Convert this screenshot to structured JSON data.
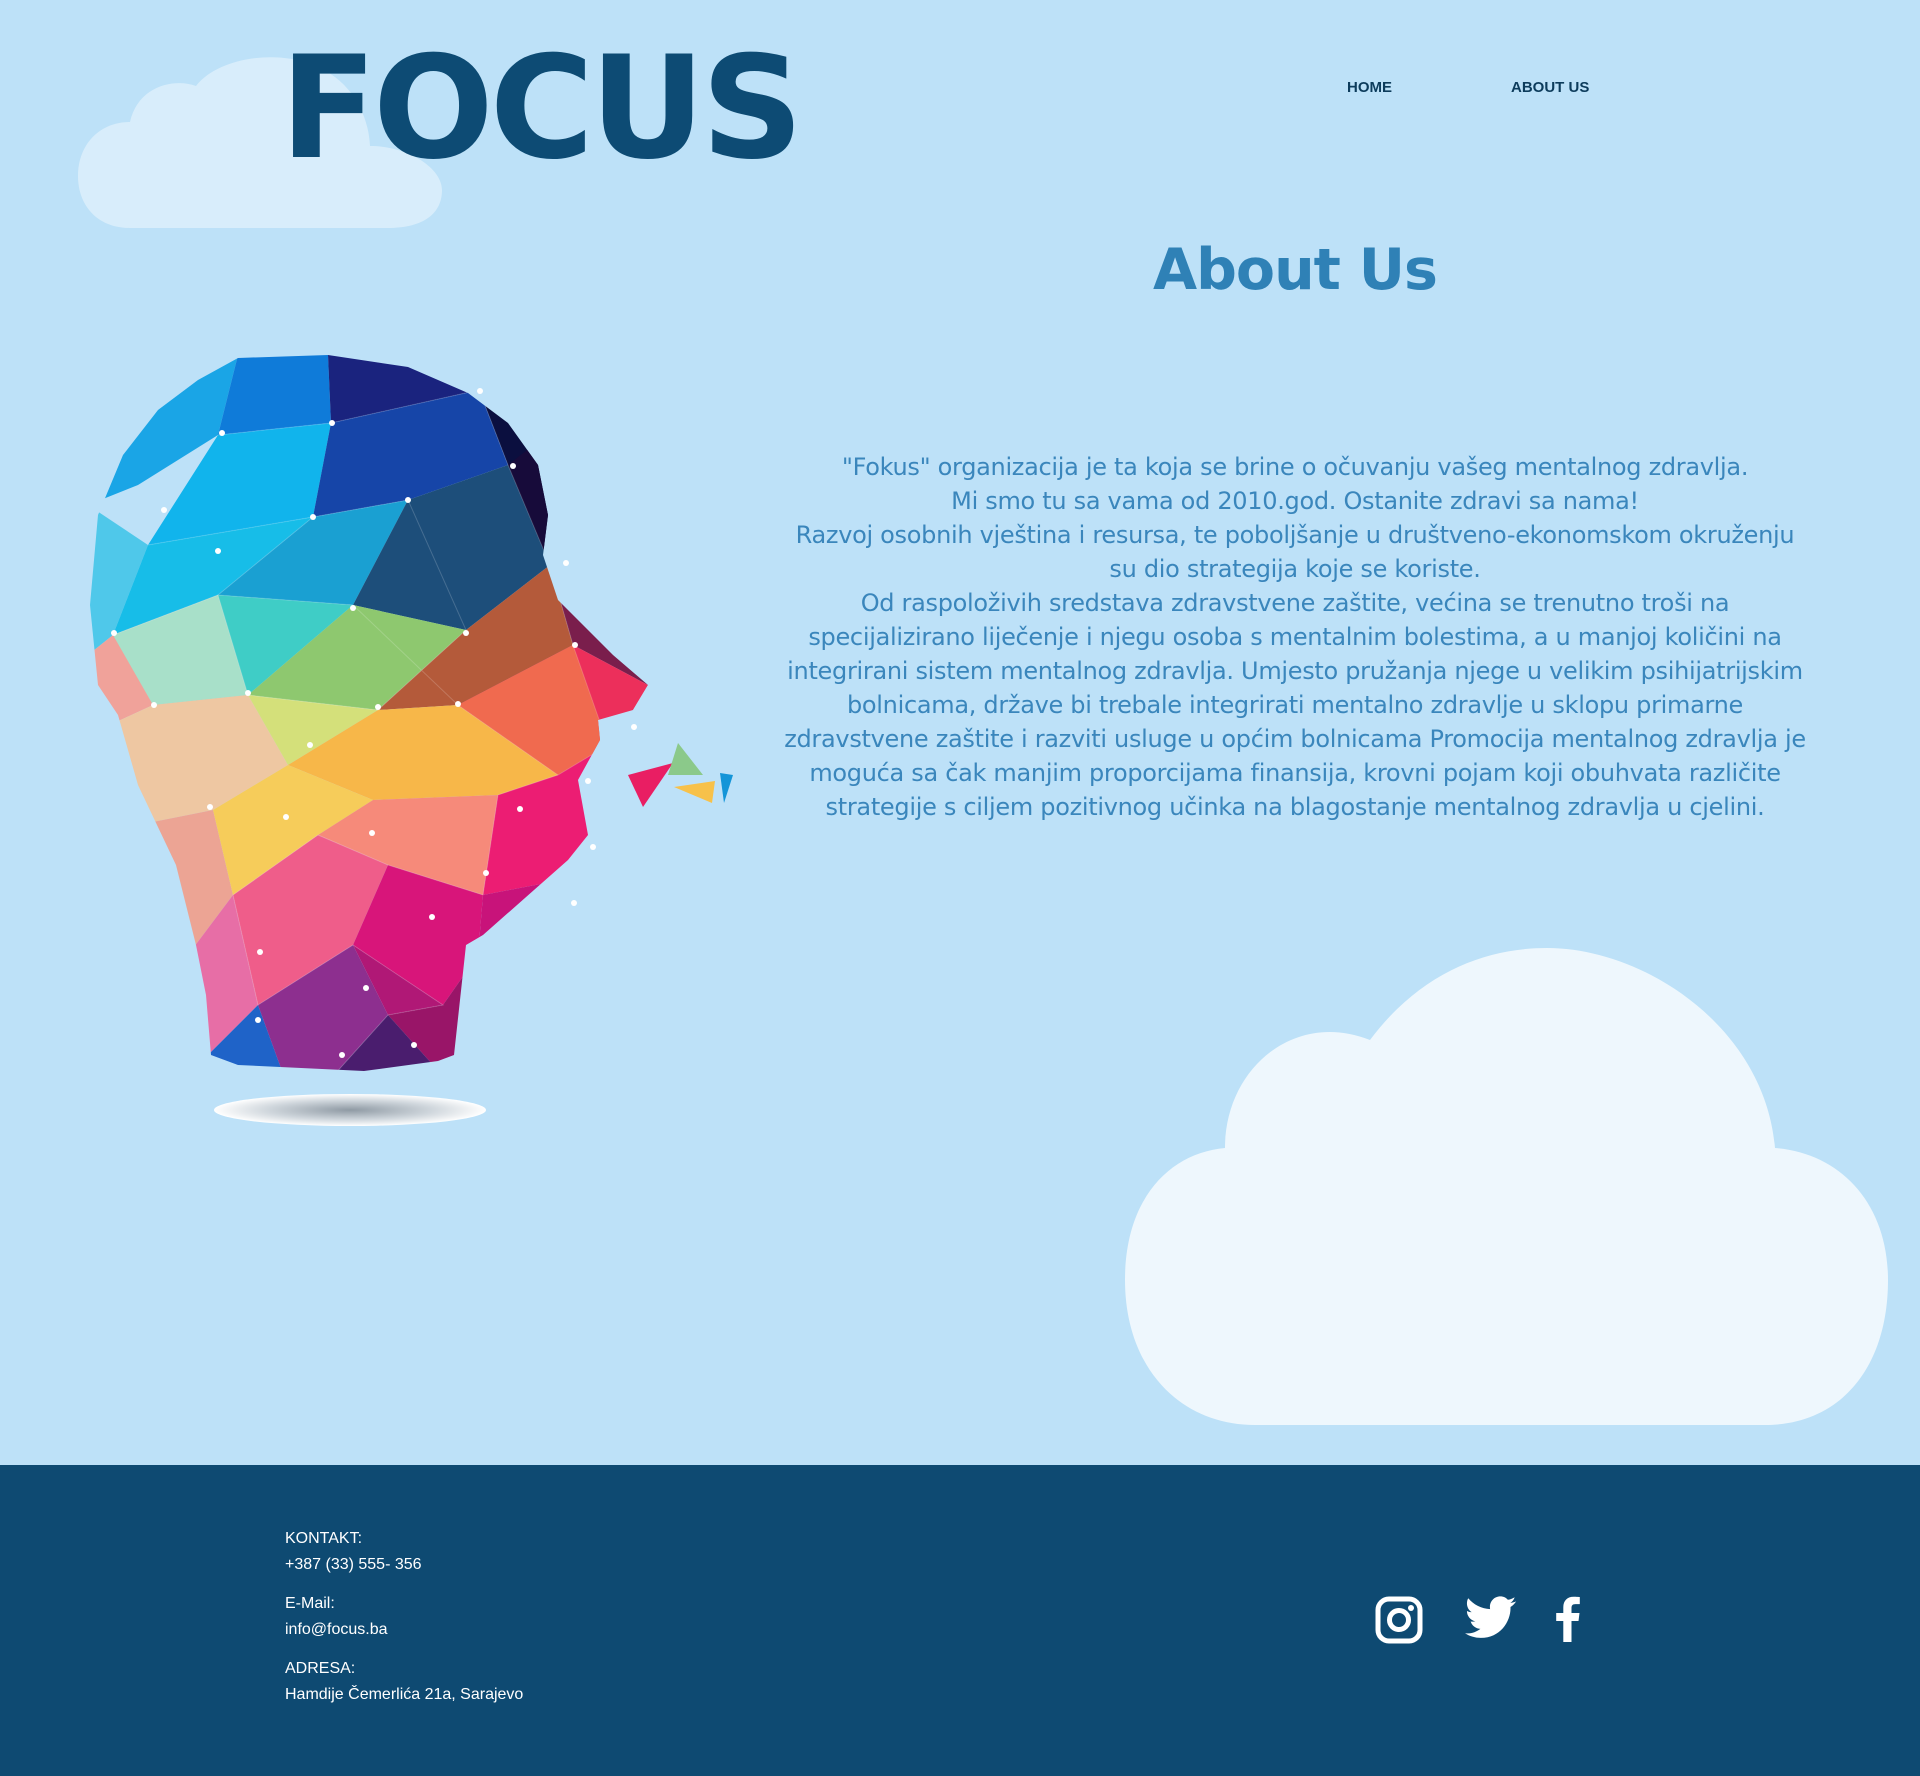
{
  "brand": {
    "logo_text": "FOCUS"
  },
  "nav": {
    "home": "HOME",
    "about": "ABOUT US"
  },
  "main": {
    "title": "About Us",
    "paragraphs": [
      "\"Fokus\" organizacija je ta koja se brine o očuvanju vašeg mentalnog zdravlja.",
      "Mi smo tu sa vama od 2010.god. Ostanite zdravi sa nama!",
      "Razvoj osobnih vještina i resursa, te poboljšanje u društveno-ekonomskom okruženju su dio strategija koje se koriste.",
      "Od raspoloživih sredstava zdravstvene zaštite, većina se trenutno troši na specijalizirano liječenje i njegu osoba s mentalnim bolestima,  a u  manjoj količini na integrirani sistem mentalnog zdravlja. Umjesto pružanja njege u velikim psihijatrijskim bolnicama, države bi trebale integrirati mentalno zdravlje u sklopu primarne zdravstvene zaštite i razviti usluge u općim bolnicama Promocija mentalnog zdravlja je moguća sa čak  manjim proporcijama finansija, krovni pojam koji obuhvata različite strategije s ciljem pozitivnog učinka na blagostanje mentalnog zdravlja u cjelini."
    ]
  },
  "footer": {
    "contact_label": "KONTAKT:",
    "phone": "+387 (33) 555- 356",
    "email_label": "E-Mail:",
    "email": "info@focus.ba",
    "address_label": "ADRESA:",
    "address": "Hamdije Čemerlića 21a, Sarajevo"
  },
  "social": {
    "icons": [
      "instagram-icon",
      "twitter-icon",
      "facebook-icon"
    ]
  },
  "colors": {
    "background": "#bde1f8",
    "footer": "#0e4a72",
    "logo": "#0d4b74",
    "heading": "#2f81b6",
    "body_text": "#3a86bc",
    "cloud": "#eef7fd"
  }
}
